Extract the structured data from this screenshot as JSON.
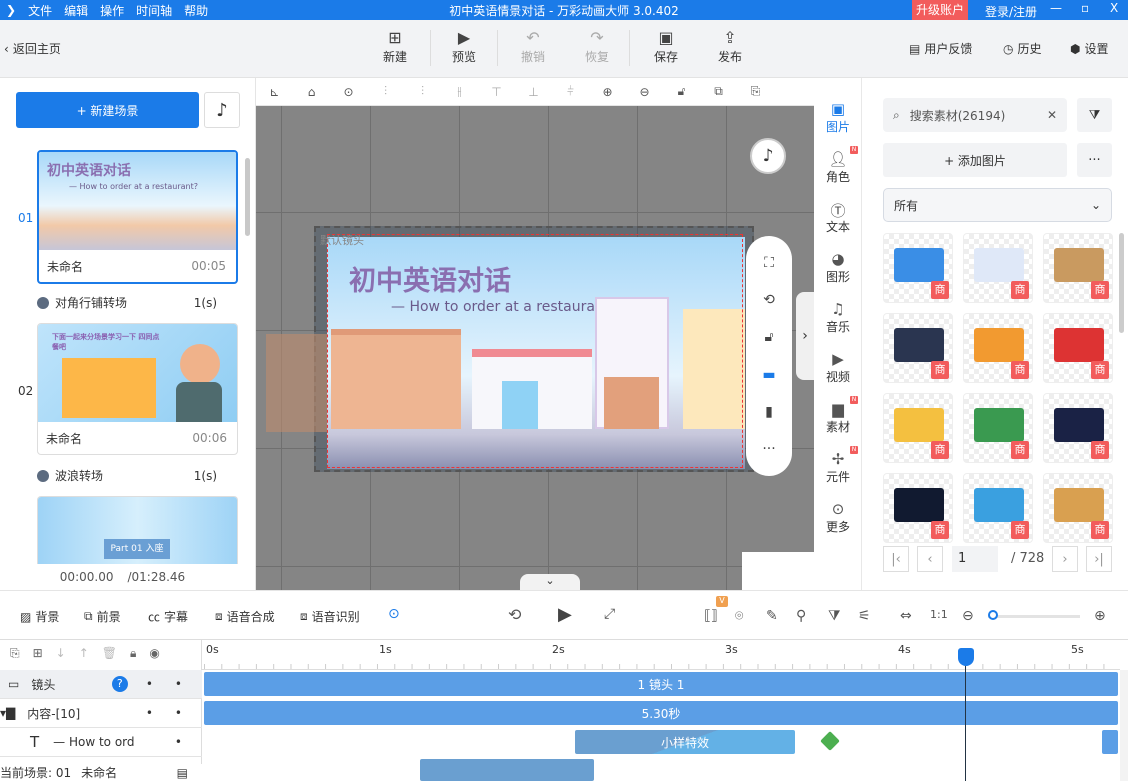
{
  "titlebar": {
    "menus": [
      "文件",
      "编辑",
      "操作",
      "时间轴",
      "帮助"
    ],
    "title": "初中英语情景对话 - 万彩动画大师 3.0.402",
    "upgrade": "升级账户",
    "login": "登录/注册"
  },
  "toolbar": {
    "back": "返回主页",
    "buttons": [
      {
        "label": "新建",
        "icon": "plus-square-icon"
      },
      {
        "label": "预览",
        "icon": "play-icon"
      },
      {
        "label": "撤销",
        "icon": "undo-icon",
        "disabled": true
      },
      {
        "label": "恢复",
        "icon": "redo-icon",
        "disabled": true
      },
      {
        "label": "保存",
        "icon": "save-icon"
      },
      {
        "label": "发布",
        "icon": "publish-icon"
      }
    ],
    "feedback": "用户反馈",
    "history": "历史",
    "settings": "设置"
  },
  "left": {
    "new_scene": "+ 新建场景",
    "scenes": [
      {
        "num": "01",
        "name": "未命名",
        "time": "00:05",
        "thumb_title": "初中英语对话",
        "thumb_sub": "— How to order at a restaurant?"
      },
      {
        "num": "02",
        "name": "未命名",
        "time": "00:06",
        "thumb_title": "下面一起来分场景学习一下 四同点餐吧"
      },
      {
        "num": "03",
        "thumb_title": "Part 01  入座"
      }
    ],
    "transitions": [
      {
        "name": "对角行铺转场",
        "dur": "1(s)"
      },
      {
        "name": "波浪转场",
        "dur": "1(s)"
      }
    ],
    "current_time": "00:00.00",
    "total_time": "/01:28.46"
  },
  "canvas": {
    "camera_label": "默认镜头",
    "art_title": "初中英语对话",
    "art_subtitle": "— How to order at a restaurant?"
  },
  "rstrip": [
    {
      "label": "图片",
      "icon": "image-icon",
      "active": true
    },
    {
      "label": "角色",
      "icon": "person-icon",
      "badge": "N"
    },
    {
      "label": "文本",
      "icon": "text-icon"
    },
    {
      "label": "图形",
      "icon": "shape-icon"
    },
    {
      "label": "音乐",
      "icon": "music-icon"
    },
    {
      "label": "视频",
      "icon": "video-icon"
    },
    {
      "label": "素材",
      "icon": "folder-icon",
      "badge": "N"
    },
    {
      "label": "元件",
      "icon": "pinwheel-icon",
      "badge": "N"
    },
    {
      "label": "更多",
      "icon": "more-icon"
    }
  ],
  "rpanel": {
    "search_placeholder": "搜索素材(26194)",
    "add_image": "+ 添加图片",
    "category": "所有",
    "tile_badge": "商",
    "tiles": [
      "banner",
      "monitor",
      "boxes",
      "worker",
      "forklift",
      "lanterns",
      "fireworks",
      "leaves",
      "blackboard",
      "tv",
      "spray-bottle",
      "bed"
    ],
    "page": "1",
    "total_pages": "/ 728"
  },
  "bottombar": {
    "items": [
      "背景",
      "前景",
      "字幕",
      "语音合成",
      "语音识别"
    ],
    "vip": "V",
    "zoom": 0.05
  },
  "timeline": {
    "ticks": [
      "0s",
      "1s",
      "2s",
      "3s",
      "4s",
      "5s"
    ],
    "playhead_s": 4.4,
    "tracks": [
      {
        "name": "镜头",
        "bar": "1 镜头 1"
      },
      {
        "name": "内容-[10]",
        "bar": "5.30秒"
      },
      {
        "name": "— How to ord",
        "bar": "小样特效"
      }
    ],
    "status_scene": "当前场景: 01",
    "status_name": "未命名"
  },
  "colors": {
    "accent": "#1b7be8",
    "upgrade": "#f25c5c",
    "bar": "#5b9ee6"
  }
}
